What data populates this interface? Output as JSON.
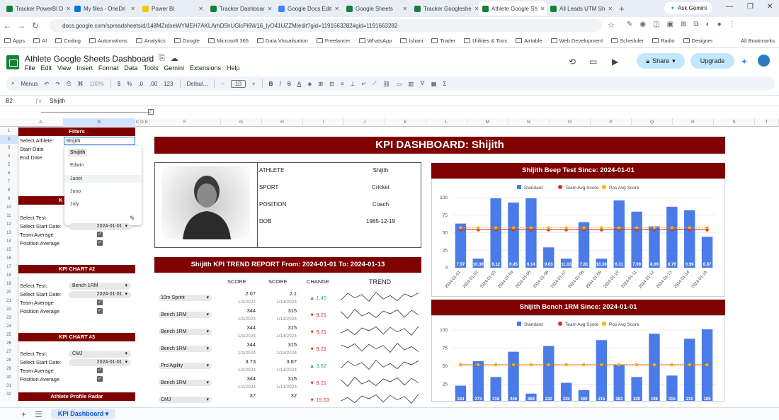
{
  "browser": {
    "tabs": [
      {
        "label": "Tracker PowerBI D",
        "color": "#188038"
      },
      {
        "label": "My files - OneDri",
        "color": "#0078d4"
      },
      {
        "label": "Power BI",
        "color": "#f2c811"
      },
      {
        "label": "Tracker Dashboar",
        "color": "#188038"
      },
      {
        "label": "Google Docs Edit",
        "color": "#4285f4"
      },
      {
        "label": "Google Sheets",
        "color": "#188038"
      },
      {
        "label": "Tracker Googleshe",
        "color": "#188038"
      },
      {
        "label": "Athlete Google Sh",
        "color": "#188038",
        "active": true
      },
      {
        "label": "All Leads UTM Sh",
        "color": "#188038"
      }
    ],
    "ask_gemini": "Ask Gemini",
    "url": "docs.google.com/spreadsheets/d/148MZrdxeWYMEH7AKLArhD5hUGlcPi6W16_lyO41UZZM/edit?gid=1191663282#gid=1191663282",
    "bookmarks": [
      "Apps",
      "AI",
      "Coding",
      "Automations",
      "Analytics",
      "Google",
      "Microsoft 365",
      "Data Visualisation",
      "Freelancer",
      "WhatsApp",
      "Ishani",
      "Trader",
      "Utilities & Toos",
      "Airtable",
      "Web Development",
      "Scheduler",
      "Radio",
      "Designer"
    ],
    "all_bookmarks": "All Bookmarks"
  },
  "sheets": {
    "title": "Athlete Google Sheets Dashboard",
    "menu": [
      "File",
      "Edit",
      "View",
      "Insert",
      "Format",
      "Data",
      "Tools",
      "Gemini",
      "Extensions",
      "Help"
    ],
    "share": "Share",
    "upgrade": "Upgrade",
    "toolbar": {
      "menus": "Menus",
      "zoom": "100%",
      "currency": "$",
      "percent": "%",
      "dec1": ".0",
      "dec2": ".00",
      "num": "123",
      "font": "Defaul...",
      "size": "10"
    },
    "namebox": "B2",
    "formula": "Shijith",
    "columns": [
      "A",
      "B",
      "C",
      "D",
      "E",
      "F",
      "G",
      "H",
      "I",
      "J",
      "K",
      "L",
      "M",
      "N",
      "O",
      "P",
      "Q",
      "R",
      "S",
      "T",
      "U"
    ],
    "sheet_tab": "KPI Dashboard"
  },
  "filters": {
    "header": "Filters",
    "select_athlete": "Select Athlete:",
    "athlete_value": "Shijith",
    "start_date": "Start Date",
    "end_date": "End Date",
    "suggestions": [
      "Shijith",
      "Edwin",
      "Janet",
      "Juno",
      "July"
    ]
  },
  "kpi1": {
    "header": "K",
    "select_test": "Select Test",
    "select_start": "Select Start Date:",
    "start": "2024-01-01",
    "team_avg": "Team Average",
    "pos_avg": "Position Average"
  },
  "kpi2": {
    "header": "KPI CHART #2",
    "select_test": "Select Test:",
    "test": "Bench 1RM",
    "select_start": "Select Start Date:",
    "start": "2024-01-01",
    "team_avg": "Team Average",
    "pos_avg": "Position Average"
  },
  "kpi3": {
    "header": "KPI CHART #3",
    "select_test": "Select Test:",
    "test": "CMJ",
    "select_start": "Select Start Date:",
    "start": "2024-01-01",
    "team_avg": "Team Average",
    "pos_avg": "Position Average"
  },
  "radar_header": "Athlete Profile Radar",
  "dashboard": {
    "title": "KPI DASHBOARD: Shijith",
    "profile": {
      "athlete_label": "ATHLETE",
      "athlete": "Shijith",
      "sport_label": "SPORT",
      "sport": "Cricket",
      "position_label": "POSITION",
      "position": "Coach",
      "dob_label": "DOB",
      "dob": "1985-12-19"
    },
    "trend_title": "Shijith KPI TREND REPORT From: 2024-01-01 To: 2024-01-13",
    "trend_headers": {
      "score1": "SCORE",
      "score2": "SCORE",
      "change": "CHANGE",
      "trend": "TREND"
    },
    "trend_rows": [
      {
        "test": "10m Sprint",
        "s1": "2.07",
        "d1": "1/1/2024",
        "s2": "2.1",
        "d2": "1/13/2024",
        "change": "▲ 1.45",
        "dir": "up"
      },
      {
        "test": "Bench 1RM",
        "s1": "344",
        "d1": "1/1/2024",
        "s2": "315",
        "d2": "1/13/2024",
        "change": "▼ 9.21",
        "dir": "down"
      },
      {
        "test": "Bench 1RM",
        "s1": "344",
        "d1": "1/1/2024",
        "s2": "315",
        "d2": "1/13/2024",
        "change": "▼ 9.21",
        "dir": "down"
      },
      {
        "test": "Bench 1RM",
        "s1": "344",
        "d1": "1/1/2024",
        "s2": "315",
        "d2": "1/13/2024",
        "change": "▼ 9.21",
        "dir": "down"
      },
      {
        "test": "Pro Agility",
        "s1": "3.73",
        "d1": "1/1/2024",
        "s2": "3.87",
        "d2": "1/13/2024",
        "change": "▲ 3.62",
        "dir": "up"
      },
      {
        "test": "Bench 1RM",
        "s1": "344",
        "d1": "1/1/2024",
        "s2": "315",
        "d2": "1/13/2024",
        "change": "▼ 9.21",
        "dir": "down"
      },
      {
        "test": "CMJ",
        "s1": "37",
        "d1": "",
        "s2": "32",
        "d2": "",
        "change": "▼ 15.63",
        "dir": "down"
      }
    ],
    "chart1_title": "Shijith Beep Test Since: 2024-01-01",
    "chart2_title": "Shijith Bench 1RM Since: 2024-01-01"
  },
  "chart_data": [
    {
      "type": "bar",
      "title": "Shijith Beep Test Since: 2024-01-01",
      "categories": [
        "2024-01-01",
        "2024-01-02",
        "2024-01-03",
        "2024-01-04",
        "2024-01-05",
        "2024-01-06",
        "2024-01-07",
        "2024-01-08",
        "2024-01-09",
        "2024-01-10",
        "2024-01-11",
        "2024-01-12",
        "2024-01-13",
        "2024-01-14",
        "2024-01-15"
      ],
      "series": [
        {
          "name": "Standard",
          "values": [
            63,
            13,
            99,
            93,
            99,
            29,
            13,
            65,
            13,
            96,
            80,
            59,
            87,
            82,
            44
          ],
          "labels": [
            "7.97",
            "10.36",
            "6.12",
            "6.45",
            "6.14",
            "9.63",
            "11.03",
            "7.81",
            "10.36",
            "6.31",
            "7.09",
            "8.09",
            "6.76",
            "6.99",
            "8.87"
          ],
          "color": "#4a7be8"
        },
        {
          "name": "Team Avg Score",
          "values": [
            54,
            54,
            54,
            54,
            54,
            54,
            54,
            54,
            54,
            54,
            54,
            54,
            54,
            54,
            54
          ],
          "color": "#d93025"
        },
        {
          "name": "Pos Avg Score",
          "values": [
            57,
            57,
            57,
            57,
            57,
            57,
            57,
            57,
            57,
            57,
            57,
            57,
            57,
            57,
            57
          ],
          "color": "#f4b400"
        }
      ],
      "ylim": [
        0,
        100
      ],
      "yticks": [
        0,
        25,
        50,
        75,
        100
      ],
      "legend": "top"
    },
    {
      "type": "bar",
      "title": "Shijith Bench 1RM Since: 2024-01-01",
      "series": [
        {
          "name": "Standard",
          "values": [
            23,
            57,
            35,
            70,
            12,
            78,
            27,
            17,
            86,
            52,
            35,
            95,
            37,
            88,
            101
          ],
          "labels": [
            "344",
            "273",
            "318",
            "246",
            "368",
            "232",
            "335",
            "360",
            "215",
            "283",
            "320",
            "196",
            "315",
            "210",
            "185"
          ],
          "color": "#4a7be8"
        },
        {
          "name": "Team Avg Score",
          "values": [
            52,
            52,
            52,
            52,
            52,
            52,
            52,
            52,
            52,
            52,
            52,
            52,
            52,
            52,
            52
          ],
          "color": "#d93025"
        },
        {
          "name": "Pos Avg Score",
          "values": [
            52,
            52,
            52,
            52,
            52,
            52,
            52,
            52,
            52,
            52,
            52,
            52,
            52,
            52,
            52
          ],
          "color": "#f4b400"
        }
      ],
      "ylim": [
        0,
        100
      ],
      "yticks": [
        25,
        50,
        75,
        100
      ],
      "legend": "top"
    }
  ]
}
